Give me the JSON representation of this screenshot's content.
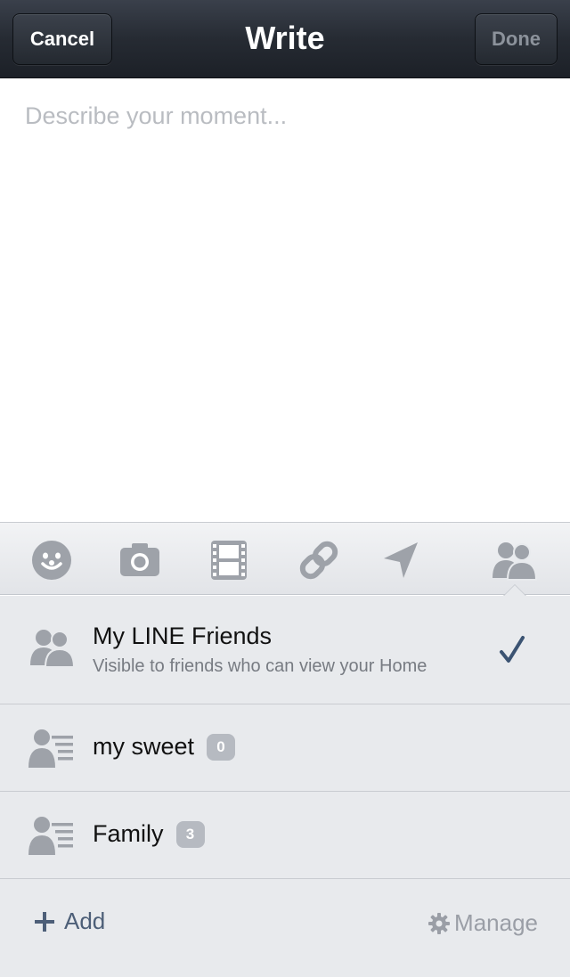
{
  "navbar": {
    "cancel_label": "Cancel",
    "title": "Write",
    "done_label": "Done"
  },
  "compose": {
    "placeholder": "Describe your moment..."
  },
  "toolbar": {
    "icons": [
      "smiley-icon",
      "camera-icon",
      "film-icon",
      "link-icon",
      "location-icon",
      "friends-icon"
    ]
  },
  "audience": {
    "items": [
      {
        "title": "My LINE Friends",
        "subtitle": "Visible to friends who can view your Home",
        "selected": true,
        "icon": "group-icon"
      },
      {
        "title": "my sweet",
        "count": "0",
        "icon": "user-list-icon"
      },
      {
        "title": "Family",
        "count": "3",
        "icon": "user-list-icon"
      }
    ],
    "add_label": "Add",
    "manage_label": "Manage"
  },
  "colors": {
    "navbar": "#262b33",
    "icon_gray": "#9ea2a9",
    "check": "#3b5372",
    "add_text": "#4d5f78"
  }
}
